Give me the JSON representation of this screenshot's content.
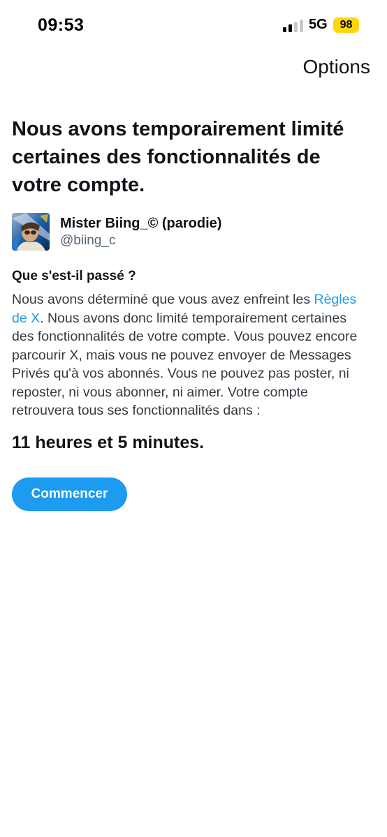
{
  "status_bar": {
    "time": "09:53",
    "network": "5G",
    "battery": "98",
    "battery_color": "#ffd60a",
    "signal_icon": "cellular-signal-icon"
  },
  "header": {
    "options_label": "Options"
  },
  "headline": "Nous avons temporairement limité certaines des fonctionnalités de votre compte.",
  "account": {
    "display_name": "Mister Biing_© (parodie)",
    "handle": "@biing_c",
    "avatar_icon": "profile-picture"
  },
  "explanation": {
    "heading": "Que s'est-il passé ?",
    "text_before_link": "Nous avons déterminé que vous avez enfreint les ",
    "link_text": "Règles de X",
    "text_after_link": ". Nous avons donc limité temporairement certaines des fonctionnalités de votre compte. Vous pouvez encore parcourir X, mais vous ne pouvez envoyer de Messages Privés qu'à vos abonnés. Vous ne pouvez pas poster, ni reposter, ni vous abonner, ni aimer. Votre compte retrouvera tous ses fonctionnalités dans :"
  },
  "countdown": "11 heures et 5 minutes.",
  "start_button_label": "Commencer",
  "colors": {
    "accent": "#1d9bf0",
    "text": "#0f1419",
    "secondary_text": "#536471"
  }
}
